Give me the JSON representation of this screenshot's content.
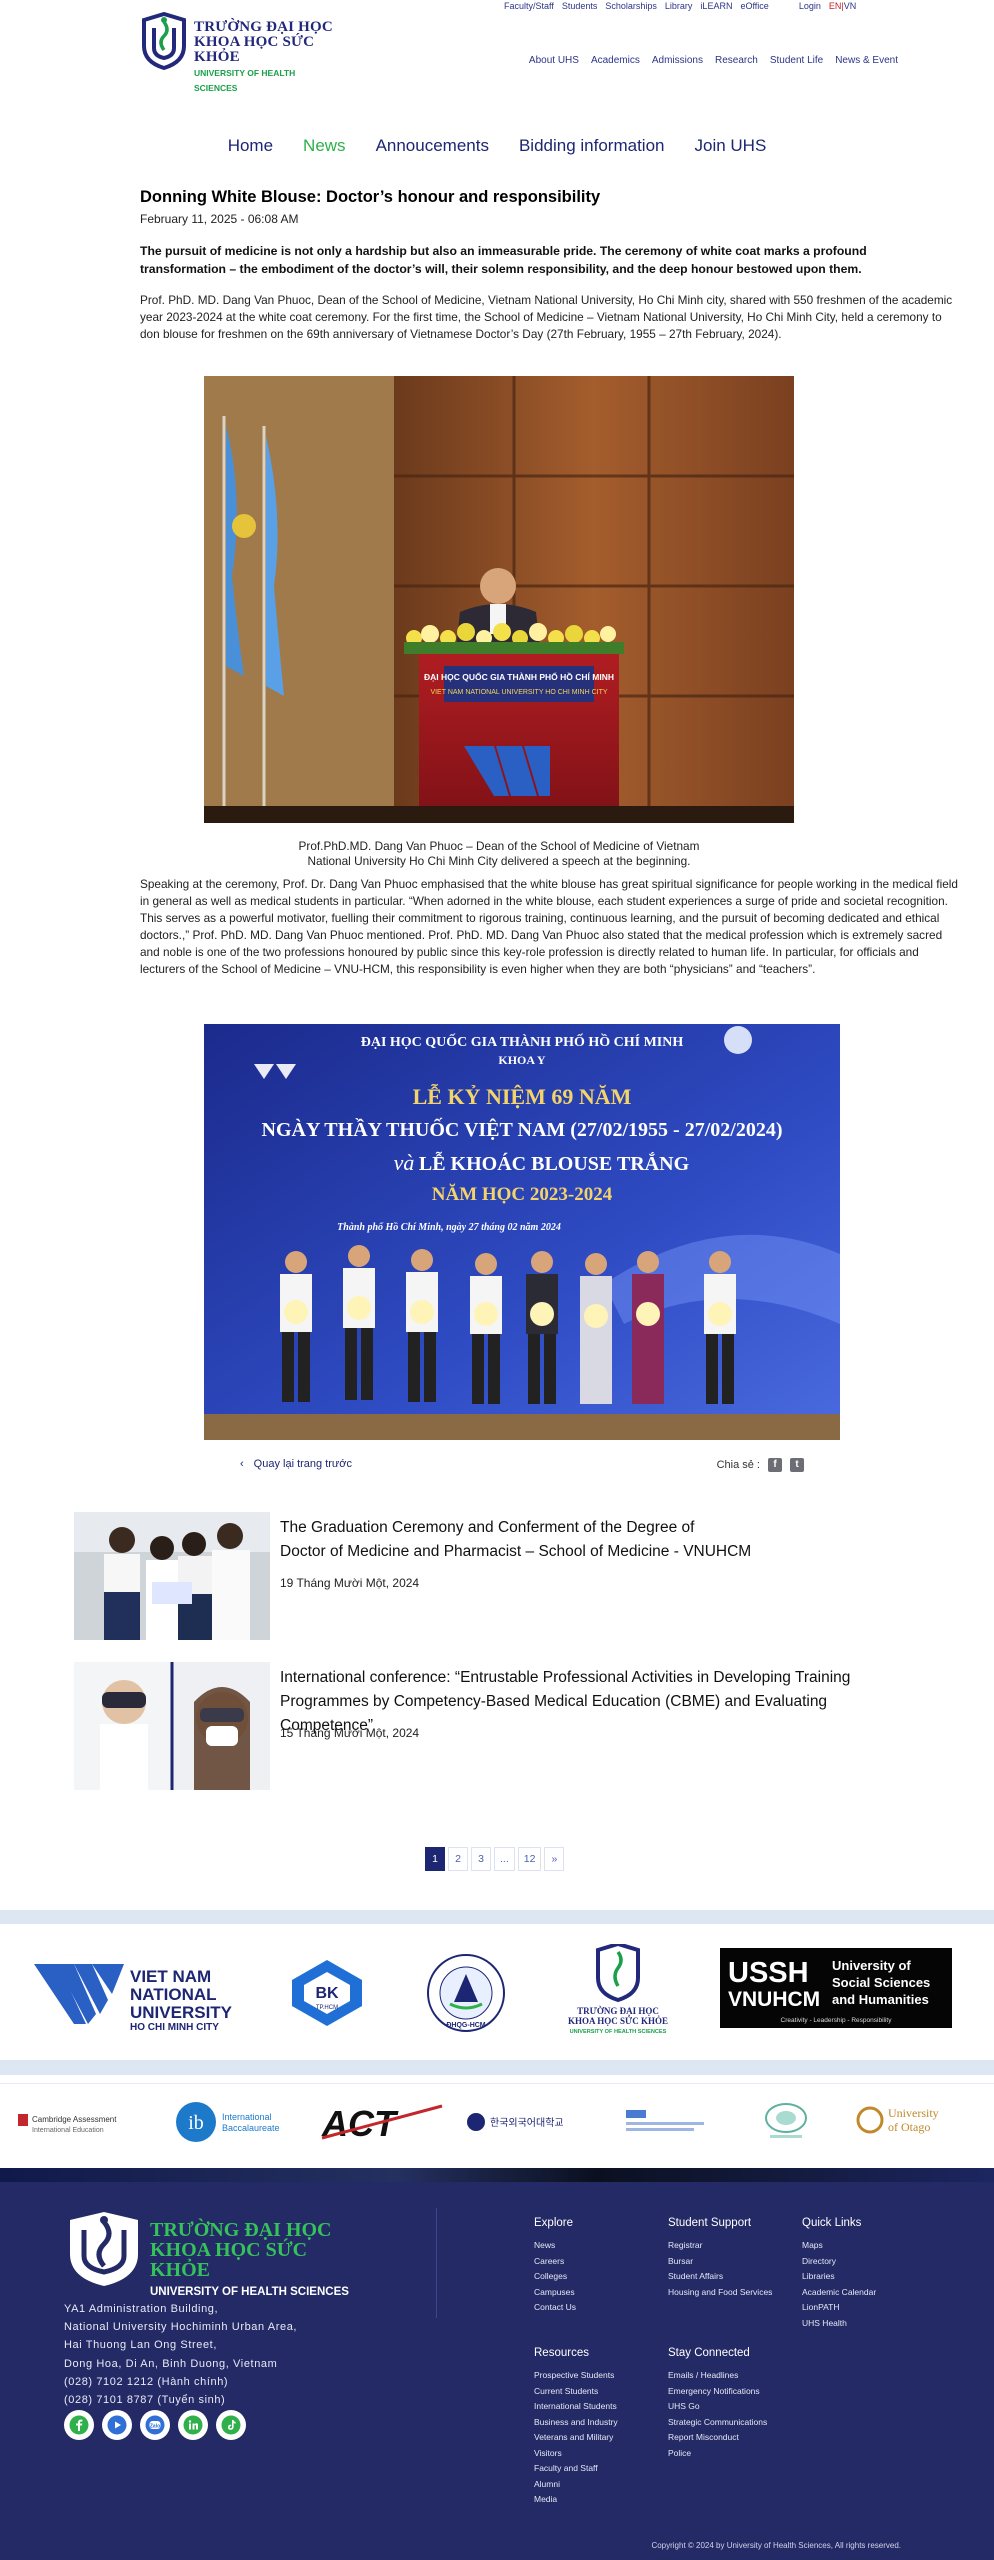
{
  "header": {
    "logo_line1": "TRƯỜNG ĐẠI HỌC",
    "logo_line2": "KHOA HỌC SỨC KHỎE",
    "logo_line3": "UNIVERSITY OF HEALTH SCIENCES",
    "topbar": [
      "Faculty/Staff",
      "Students",
      "Scholarships",
      "Library",
      "iLEARN",
      "eOffice"
    ],
    "login": "Login",
    "lang_en": "EN",
    "lang_sep": "|",
    "lang_vn": "VN",
    "mainnav": [
      "About UHS",
      "Academics",
      "Admissions",
      "Research",
      "Student Life",
      "News & Event"
    ]
  },
  "pagenav": {
    "items": [
      "Home",
      "News",
      "Annoucements",
      "Bidding information",
      "Join UHS"
    ],
    "active": "News"
  },
  "article": {
    "title": "Donning White Blouse: Doctor’s honour and responsibility",
    "date": "February 11, 2025 - 06:08 AM",
    "lead": "The pursuit of medicine is not only a hardship but also an immeasurable pride. The ceremony of white coat marks a profound transformation – the embodiment of the doctor’s will, their solemn responsibility, and the deep honour bestowed upon them.",
    "para1": "Prof. PhD. MD.  Dang Van Phuoc, Dean of the School of Medicine, Vietnam National University, Ho Chi Minh city, shared with 550 freshmen of the academic year 2023-2024 at the white coat ceremony. For the first time, the School of Medicine – Vietnam National University, Ho Chi Minh City, held a ceremony to don blouse for freshmen on the 69th anniversary of Vietnamese Doctor’s Day (27th February, 1955 – 27th February, 2024).",
    "photo1_podium_line1": "ĐẠI HỌC QUỐC GIA THÀNH PHỐ HỒ CHÍ MINH",
    "photo1_podium_line2": "VIET NAM NATIONAL UNIVERSITY HO CHI MINH CITY",
    "caption1_line1": "Prof.PhD.MD. Dang Van Phuoc – Dean of the School of Medicine of Vietnam",
    "caption1_line2": "National University Ho Chi Minh City delivered a speech at the beginning.",
    "para2": "Speaking at the ceremony, Prof. Dr. Dang Van Phuoc emphasised that the white blouse has great spiritual significance for people working in the medical field in general as well as medical students in particular. “When adorned in the white blouse, each student experiences a surge of pride and societal recognition. This serves as a powerful motivator, fuelling their commitment to rigorous training, continuous learning, and the pursuit of becoming dedicated and ethical doctors.,” Prof. PhD. MD. Dang Van Phuoc mentioned. Prof. PhD. MD. Dang Van Phuoc also stated that the medical profession which is extremely sacred and noble is one of the two professions honoured by public since this key-role profession is directly related to human life. In particular, for officials and lecturers of the School of Medicine – VNU-HCM, this responsibility is even higher when they are both “physicians” and “teachers”.",
    "banner_line1": "ĐẠI HỌC QUỐC GIA THÀNH PHỐ HỒ CHÍ MINH",
    "banner_line2": "KHOA Y",
    "banner_line3": "LỄ KỶ NIỆM 69 NĂM",
    "banner_line4": "NGÀY THẦY THUỐC VIỆT NAM (27/02/1955 - 27/02/2024)",
    "banner_line5_a": "và",
    "banner_line5_b": "LỄ KHOÁC BLOUSE TRẮNG",
    "banner_line6": "NĂM HỌC 2023-2024",
    "banner_line7": "Thành phố Hồ Chí Minh, ngày 27 tháng 02 năm 2024",
    "back_label": "Quay lại trang trước",
    "share_label": "Chia sẻ :"
  },
  "related": [
    {
      "title_line1": "The Graduation Ceremony and Conferment of the Degree of",
      "title_line2": "Doctor of Medicine and Pharmacist – School of Medicine - VNUHCM",
      "date": "19 Tháng Mười Một, 2024"
    },
    {
      "title_line1": "International conference: “Entrustable Professional Activities in Developing Training",
      "title_line2": "Programmes by Competency-Based Medical Education (CBME) and Evaluating Competence”",
      "date": "15 Tháng Mười Một, 2024"
    }
  ],
  "pagination": [
    "1",
    "2",
    "3",
    "...",
    "12",
    "»"
  ],
  "partners": {
    "vnu_line1": "VIET NAM",
    "vnu_line2": "NATIONAL",
    "vnu_line3": "UNIVERSITY",
    "vnu_line4": "HO CHI MINH CITY",
    "bk_label": "BK",
    "bk_sub": "TP.HCM",
    "ag_label": "ĐHQG-HCM",
    "uhs_line1": "TRƯỜNG ĐẠI HỌC",
    "uhs_line2": "KHOA HỌC SỨC KHỎE",
    "uhs_line3": "UNIVERSITY OF HEALTH SCIENCES",
    "ussh_big1": "USSH",
    "ussh_big2": "VNUHCM",
    "ussh_side1": "University of",
    "ussh_side2": "Social Sciences",
    "ussh_side3": "and Humanities",
    "ussh_tag": "Creativity - Leadership - Responsibility",
    "cambridge1": "Cambridge Assessment",
    "cambridge2": "International Education",
    "ib1": "International",
    "ib2": "Baccalaureate",
    "act": "ACT",
    "korean": "한국외국어대학교",
    "otago1": "University",
    "otago2": "of Otago"
  },
  "footer": {
    "logo_line1": "TRƯỜNG ĐẠI HỌC",
    "logo_line2": "KHOA HỌC SỨC KHỎE",
    "logo_line3": "UNIVERSITY OF HEALTH SCIENCES",
    "address": [
      "YA1 Administration Building,",
      "National University Hochiminh Urban Area,",
      "Hai Thuong Lan Ong Street,",
      "Dong Hoa, Di An, Binh Duong, Vietnam",
      "(028) 7102 1212 (Hành chính)",
      "(028) 7101 8787 (Tuyển sinh)"
    ],
    "social": [
      "facebook-icon",
      "youtube-icon",
      "zalo-icon",
      "linkedin-icon",
      "tiktok-icon"
    ],
    "explore": {
      "title": "Explore",
      "items": [
        "News",
        "Careers",
        "Colleges",
        "Campuses",
        "Contact Us"
      ]
    },
    "student_support": {
      "title": "Student Support",
      "items": [
        "Registrar",
        "Bursar",
        "Student Affairs",
        "Housing and Food Services"
      ]
    },
    "quick_links": {
      "title": "Quick Links",
      "items": [
        "Maps",
        "Directory",
        "Libraries",
        "Academic Calendar",
        "LionPATH",
        "UHS Health"
      ]
    },
    "resources": {
      "title": "Resources",
      "items": [
        "Prospective Students",
        "Current Students",
        "International Students",
        "Business and Industry",
        "Veterans and Military",
        "Visitors",
        "Faculty and Staff",
        "Alumni",
        "Media"
      ]
    },
    "stay_connected": {
      "title": "Stay Connected",
      "items": [
        "Emails / Headlines",
        "Emergency Notifications",
        "UHS Go",
        "Strategic Communications",
        "Report Misconduct",
        "Police"
      ]
    },
    "copyright": "Copyright © 2024 by University of Health Sciences, All rights reserved."
  },
  "colors": {
    "brand_navy": "#1d2673",
    "brand_green": "#2fb04a",
    "footer_bg": "#242a66",
    "lang_red": "#c4232b"
  }
}
